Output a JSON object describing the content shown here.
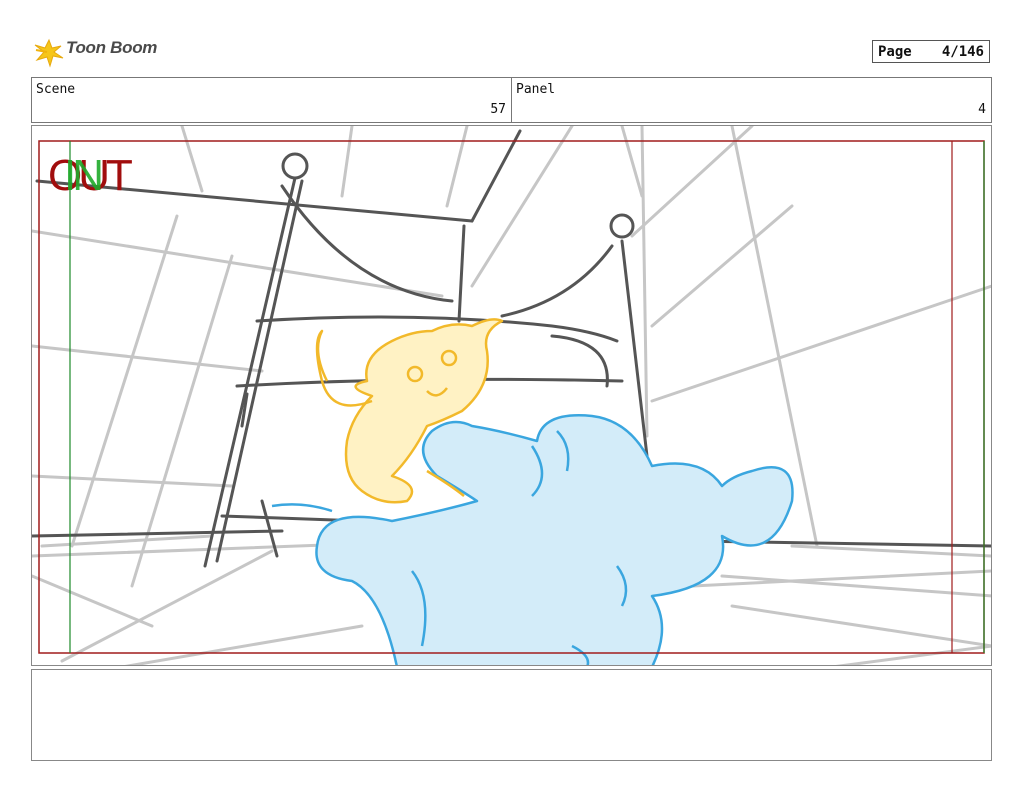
{
  "header": {
    "logo_text": "Toon Boom",
    "page_label": "Page",
    "page_value": "4/146"
  },
  "info": {
    "scene_label": "Scene",
    "scene_value": "57",
    "panel_label": "Panel",
    "panel_value": "4"
  },
  "panel": {
    "transition_out": "OUT",
    "transition_in": "IN",
    "colors": {
      "safe_frame": "#a11c1c",
      "title_safe": "#1d8a2a",
      "sketch_gray": "#c6c6c6",
      "sketch_dark": "#555555",
      "cat_line": "#f2b92a",
      "cat_fill": "#fff2c4",
      "creature_line": "#3aa6df",
      "creature_fill": "#d3ecf9"
    }
  },
  "caption": {
    "text": ""
  }
}
